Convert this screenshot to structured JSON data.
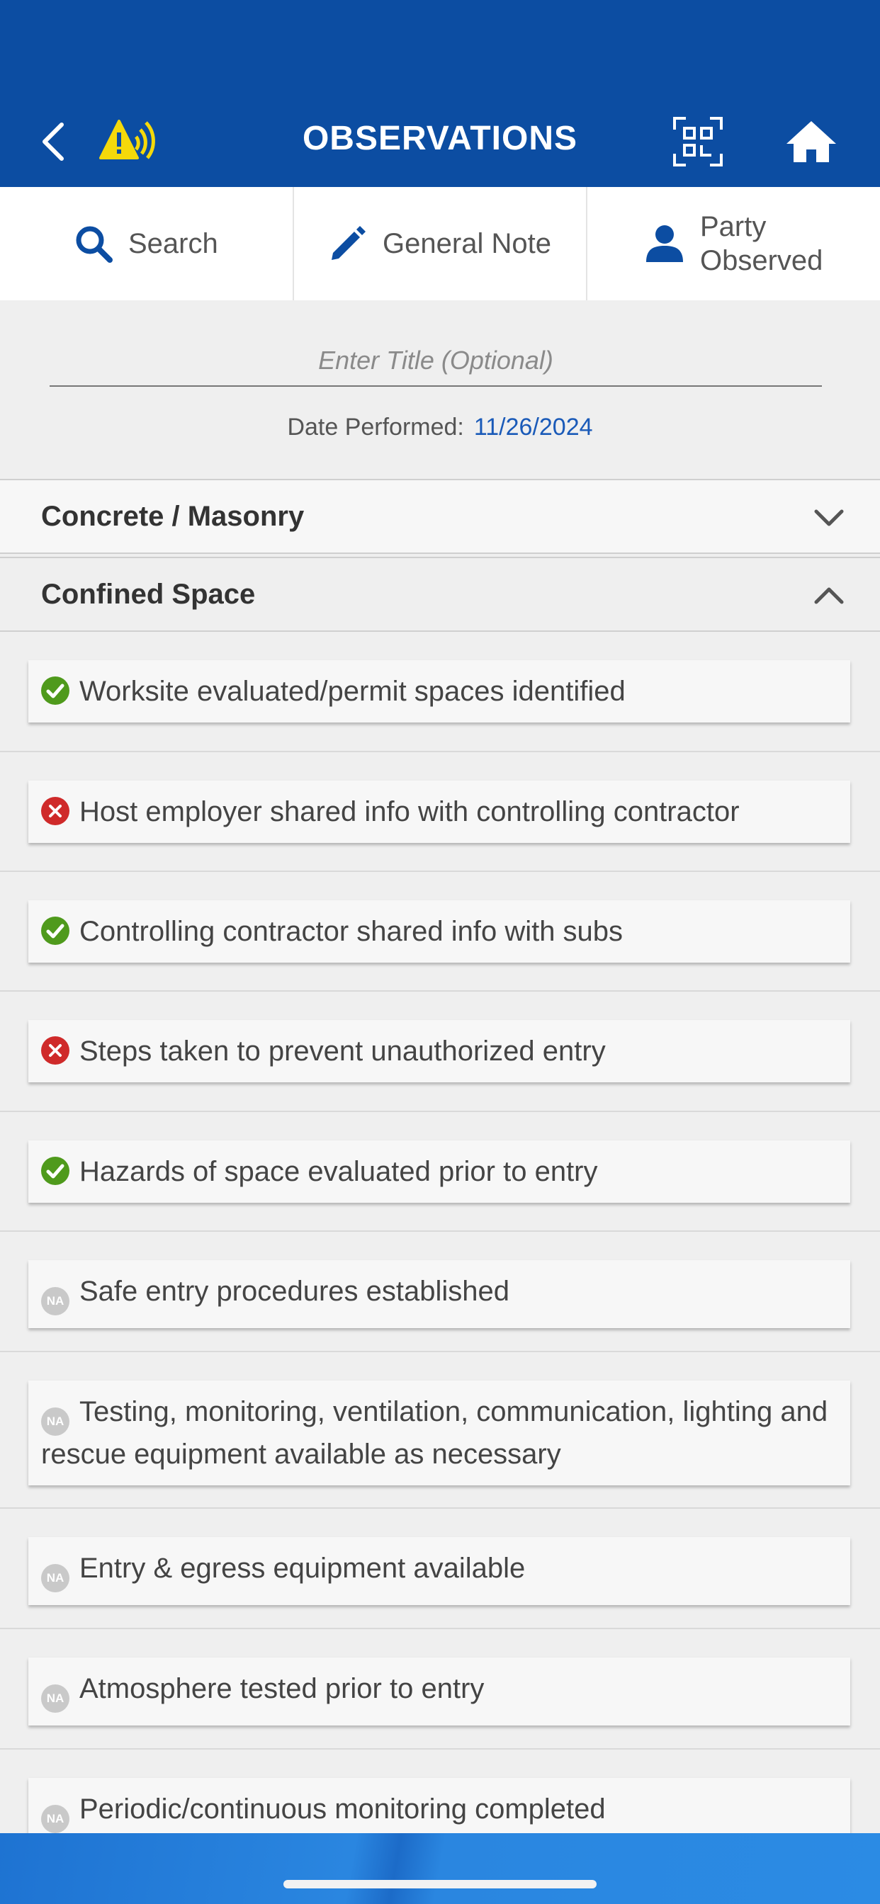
{
  "header": {
    "title": "OBSERVATIONS"
  },
  "toolbar": {
    "search": "Search",
    "general_note": "General Note",
    "party_observed_line1": "Party",
    "party_observed_line2": "Observed"
  },
  "form": {
    "title_placeholder": "Enter Title (Optional)",
    "date_label": "Date Performed:",
    "date_value": "11/26/2024"
  },
  "categories": [
    {
      "label": "Concrete / Masonry",
      "state": "collapsed"
    },
    {
      "label": "Confined Space",
      "state": "expanded"
    }
  ],
  "items": [
    {
      "text": "Worksite evaluated/permit spaces identified",
      "status": "ok"
    },
    {
      "text": "Host employer shared info with controlling contractor",
      "status": "no"
    },
    {
      "text": "Controlling contractor shared info with subs",
      "status": "ok"
    },
    {
      "text": "Steps taken to prevent unauthorized entry",
      "status": "no"
    },
    {
      "text": "Hazards of space evaluated prior to entry",
      "status": "ok"
    },
    {
      "text": "Safe entry procedures established",
      "status": "na"
    },
    {
      "text": "Testing, monitoring, ventilation, communication, lighting and rescue equipment available as necessary",
      "status": "na"
    },
    {
      "text": "Entry & egress equipment available",
      "status": "na"
    },
    {
      "text": "Atmosphere tested prior to entry",
      "status": "na"
    },
    {
      "text": "Periodic/continuous monitoring completed",
      "status": "na"
    }
  ],
  "status_labels": {
    "na": "NA"
  },
  "colors": {
    "header_bg": "#0c4da2",
    "ok": "#4f9a1c",
    "no": "#cf2a2a",
    "na": "#c9c9c9",
    "warning": "#f5d90a",
    "date_value": "#1a5ab8"
  },
  "icons": {
    "back": "chevron-left-icon",
    "warning": "warning-signal-icon",
    "qr": "qr-scan-icon",
    "home": "home-icon",
    "search": "search-icon",
    "note": "pencil-icon",
    "party": "person-icon"
  }
}
